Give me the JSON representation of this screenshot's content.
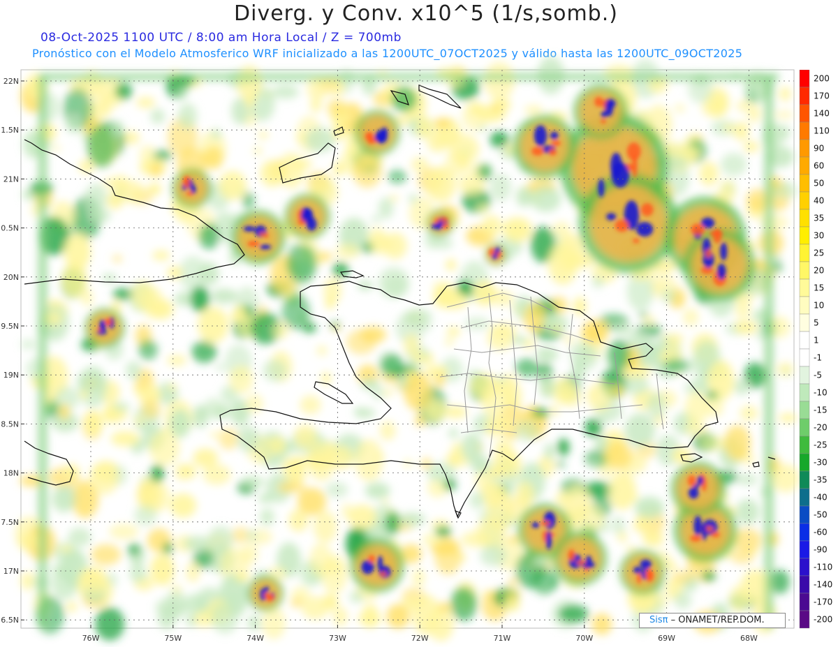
{
  "title": "Diverg. y Conv. x10^5 (1/s,somb.)",
  "subtitle_line1": "08-Oct-2025  1100 UTC / 8:00 am Hora Local / Z = 700mb",
  "subtitle_line2": "Pronóstico con el Modelo Atmosferico WRF inicializado a las 1200UTC_07OCT2025 y válido hasta las  1200UTC_09OCT2025",
  "credit": {
    "brand": "Sisπ",
    "text": "– ONAMET/REP.DOM."
  },
  "lat_labels": [
    "22N",
    "1.5N",
    "21N",
    "0.5N",
    "20N",
    "9.5N",
    "19N",
    "8.5N",
    "18N",
    "7.5N",
    "17N",
    "6.5N"
  ],
  "lon_labels": [
    "76W",
    "75W",
    "74W",
    "73W",
    "72W",
    "71W",
    "70W",
    "69W",
    "68W"
  ],
  "colorbar": {
    "labels": [
      "200",
      "170",
      "140",
      "110",
      "90",
      "60",
      "50",
      "40",
      "35",
      "30",
      "25",
      "20",
      "15",
      "10",
      "5",
      "1",
      "-1",
      "-5",
      "-10",
      "-15",
      "-20",
      "-25",
      "-30",
      "-35",
      "-40",
      "-50",
      "-60",
      "-90",
      "-110",
      "-140",
      "-170",
      "-200"
    ],
    "colors": [
      "#ff0000",
      "#ff2a00",
      "#ff5500",
      "#ff7a00",
      "#ff9900",
      "#ffaa00",
      "#ffbe00",
      "#ffd000",
      "#ffe000",
      "#ffee00",
      "#fff333",
      "#fff766",
      "#fffa99",
      "#fffcc0",
      "#fffee0",
      "#ffffff",
      "#ffffff",
      "#e2f4df",
      "#bfe9bb",
      "#99dc95",
      "#6ecd6a",
      "#3fbb3d",
      "#17a82a",
      "#0f8a58",
      "#0d6e8c",
      "#0a4cc4",
      "#0a2ee6",
      "#1a1ae6",
      "#2b10cc",
      "#3a0aaa",
      "#4b0a92",
      "#5a0a86"
    ]
  },
  "map": {
    "features": [
      "divergence-convergence-field",
      "coastlines",
      "province-boundaries",
      "graticule"
    ],
    "field_colors": {
      "convergence": "#2ba84a",
      "divergence": "#ffd24a",
      "strong_convergence": "#1a1ad0",
      "strong_divergence": "#ff5a1f"
    }
  }
}
